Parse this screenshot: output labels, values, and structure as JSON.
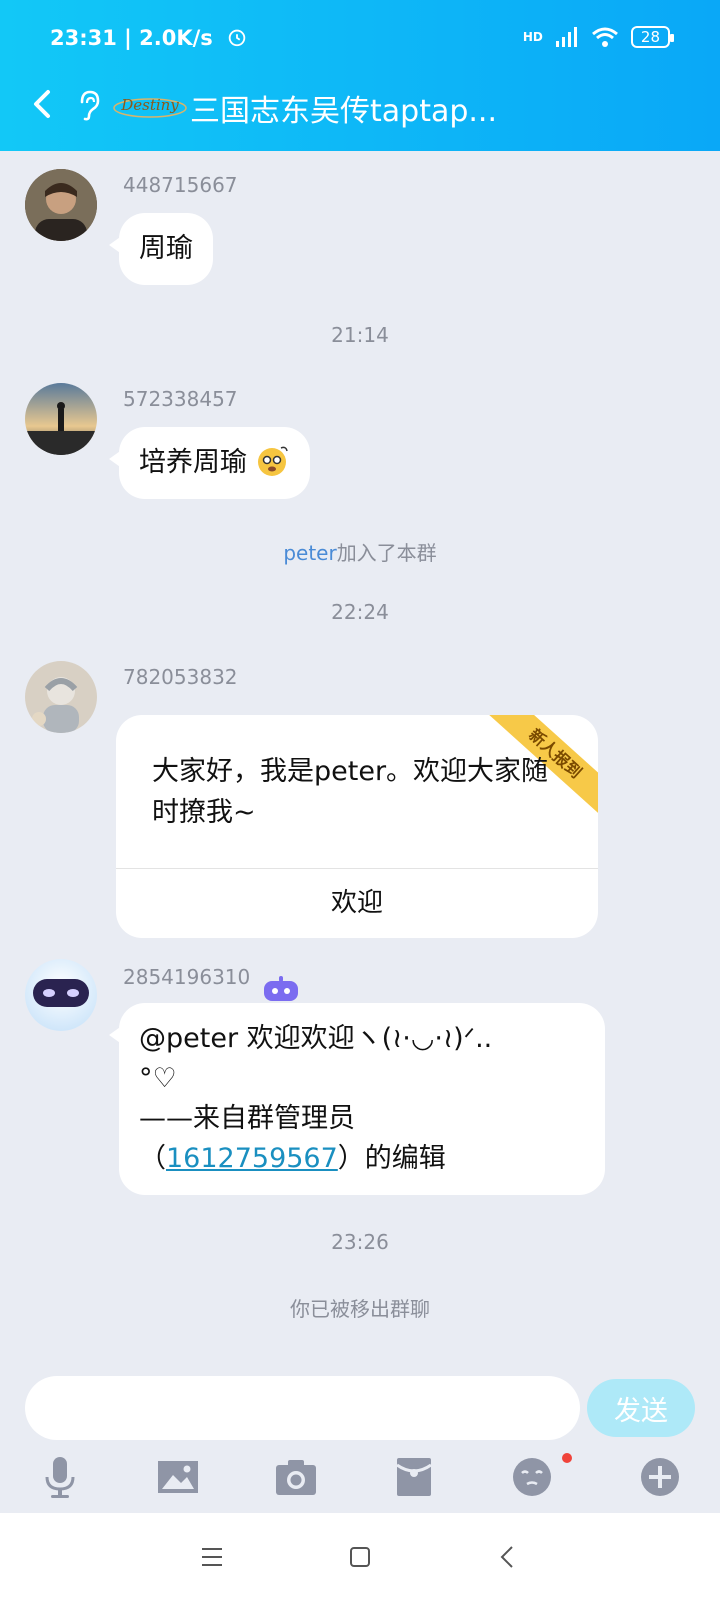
{
  "status_bar": {
    "time": "23:31",
    "net_speed": "2.0K/s",
    "network": "HD",
    "battery": "28"
  },
  "header": {
    "title": "三国志东吴传taptap...",
    "logo_text": "Destiny"
  },
  "messages": [
    {
      "sender": "448715667",
      "text": "周瑜"
    },
    {
      "time": "21:14"
    },
    {
      "sender": "572338457",
      "text": "培养周瑜"
    },
    {
      "system_name": "peter",
      "system_text": "加入了本群"
    },
    {
      "time": "22:24"
    },
    {
      "sender": "782053832",
      "card_text": "大家好，我是peter。欢迎大家随时撩我~",
      "card_action": "欢迎",
      "ribbon": "新人报到"
    },
    {
      "sender": "2854196310",
      "line1": "@peter 欢迎欢迎ヽ(≀·◡·≀)ᐟ..",
      "line2": "°♡",
      "line3": "——来自群管理员",
      "paren_open": "（",
      "admin_id": "1612759567",
      "line4_tail": "）的编辑"
    },
    {
      "time": "23:26"
    },
    {
      "system_text": "你已被移出群聊"
    }
  ],
  "input": {
    "placeholder": "",
    "send_label": "发送"
  },
  "toolbar_icons": [
    "microphone-icon",
    "image-icon",
    "camera-icon",
    "red-packet-icon",
    "emoji-icon",
    "plus-icon"
  ],
  "colors": {
    "header_start": "#12c8f7",
    "header_end": "#0aa8f7",
    "chat_bg": "#e9ecf3",
    "link": "#1a8fc0",
    "ribbon": "#f7c948"
  }
}
